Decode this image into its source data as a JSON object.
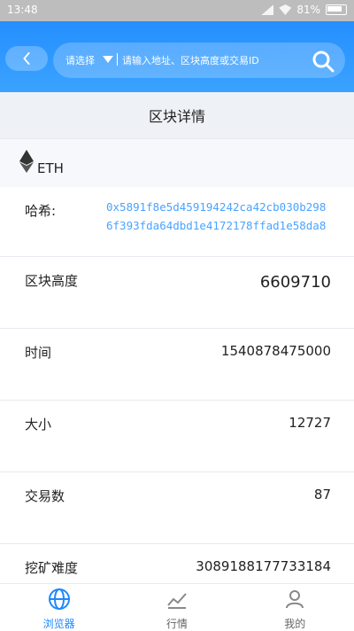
{
  "status_bar": {
    "time": "13:48",
    "battery_text": "81%"
  },
  "header": {
    "select_label": "请选择",
    "search_placeholder": "请输入地址、区块高度或交易ID"
  },
  "page_title": "区块详情",
  "coin": {
    "name": "ETH",
    "icon": "eth-diamond-icon"
  },
  "details": {
    "hash_label": "哈希:",
    "hash_value": "0x5891f8e5d459194242ca42cb030b2986f393fda64dbd1e4172178ffad1e58da8",
    "height_label": "区块高度",
    "height_value": "6609710",
    "time_label": "时间",
    "time_value": "1540878475000",
    "size_label": "大小",
    "size_value": "12727",
    "tx_label": "交易数",
    "tx_value": "87",
    "difficulty_label": "挖矿难度",
    "difficulty_value": "3089188177733184"
  },
  "tabs": [
    {
      "label": "浏览器",
      "icon": "globe-icon",
      "active": true
    },
    {
      "label": "行情",
      "icon": "chart-icon",
      "active": false
    },
    {
      "label": "我的",
      "icon": "user-icon",
      "active": false
    }
  ],
  "colors": {
    "accent": "#1e88ff",
    "hash_link": "#4aa3ff"
  }
}
